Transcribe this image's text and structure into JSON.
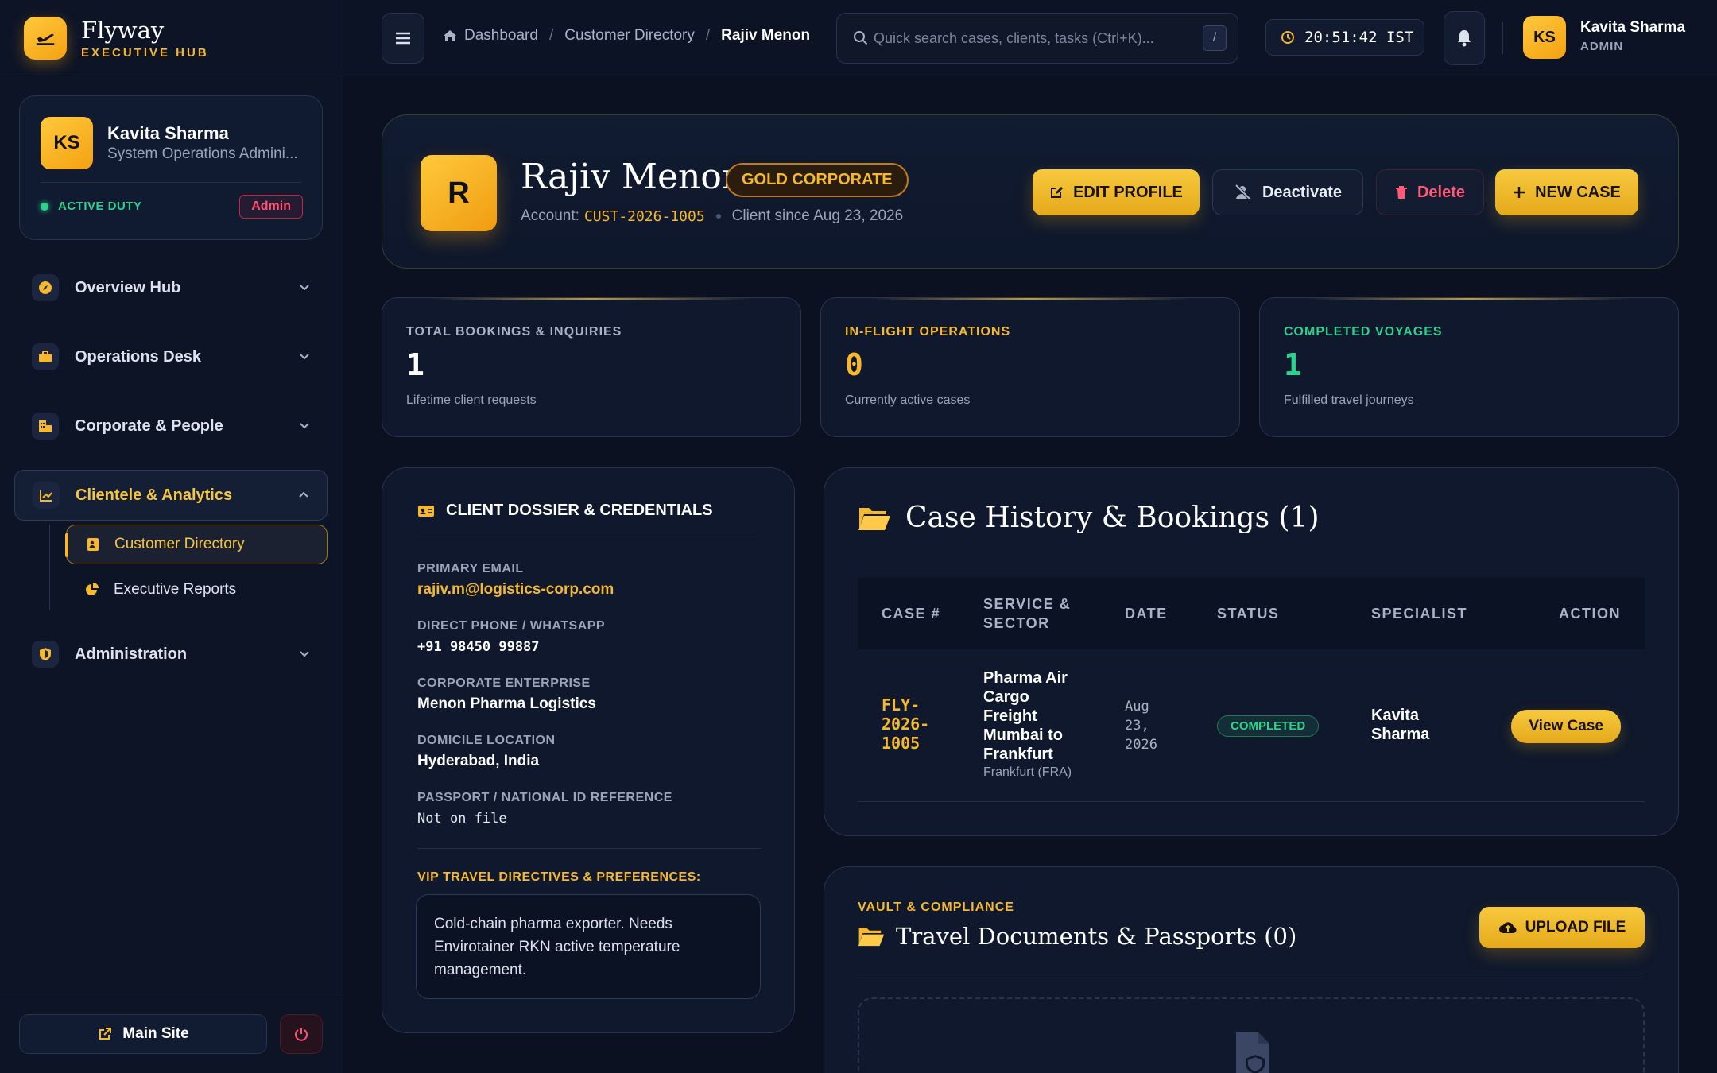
{
  "brand": {
    "name": "Flyway",
    "subtitle": "EXECUTIVE HUB"
  },
  "sidebar": {
    "user": {
      "initials": "KS",
      "name": "Kavita Sharma",
      "role": "System Operations Admini...",
      "status": "ACTIVE DUTY",
      "badge": "Admin"
    },
    "nav": [
      {
        "label": "Overview Hub",
        "icon": "compass-icon",
        "expanded": false
      },
      {
        "label": "Operations Desk",
        "icon": "briefcase-icon",
        "expanded": false
      },
      {
        "label": "Corporate & People",
        "icon": "building-icon",
        "expanded": false
      },
      {
        "label": "Clientele & Analytics",
        "icon": "chart-line-icon",
        "expanded": true
      },
      {
        "label": "Administration",
        "icon": "shield-icon",
        "expanded": false
      }
    ],
    "subnav": [
      {
        "label": "Customer Directory",
        "icon": "address-card-icon",
        "active": true
      },
      {
        "label": "Executive Reports",
        "icon": "pie-chart-icon",
        "active": false
      }
    ],
    "main_site": "Main Site"
  },
  "topbar": {
    "breadcrumb": [
      "Dashboard",
      "Customer Directory",
      "Rajiv Menon"
    ],
    "search_placeholder": "Quick search cases, clients, tasks (Ctrl+K)...",
    "search_shortcut": "/",
    "clock": "20:51:42 IST",
    "user": {
      "initials": "KS",
      "name": "Kavita Sharma",
      "role": "ADMIN"
    }
  },
  "client": {
    "initial": "R",
    "name": "Rajiv Menon",
    "tier": "GOLD CORPORATE",
    "account_label": "Account:",
    "account_id": "CUST-2026-1005",
    "since": "Client since Aug 23, 2026"
  },
  "actions": {
    "edit": "EDIT PROFILE",
    "deactivate": "Deactivate",
    "delete": "Delete",
    "new_case": "NEW CASE"
  },
  "stats": [
    {
      "label": "TOTAL BOOKINGS & INQUIRIES",
      "value": "1",
      "sub": "Lifetime client requests",
      "color": "#aab3c6"
    },
    {
      "label": "IN-FLIGHT OPERATIONS",
      "value": "0",
      "sub": "Currently active cases",
      "color": "#f5b82e"
    },
    {
      "label": "COMPLETED VOYAGES",
      "value": "1",
      "sub": "Fulfilled travel journeys",
      "color": "#2fd18f"
    }
  ],
  "dossier": {
    "title": "CLIENT DOSSIER & CREDENTIALS",
    "fields": [
      {
        "label": "PRIMARY EMAIL",
        "value": "rajiv.m@logistics-corp.com"
      },
      {
        "label": "DIRECT PHONE / WHATSAPP",
        "value": "+91 98450 99887"
      },
      {
        "label": "CORPORATE ENTERPRISE",
        "value": "Menon Pharma Logistics"
      },
      {
        "label": "DOMICILE LOCATION",
        "value": "Hyderabad, India"
      },
      {
        "label": "PASSPORT / NATIONAL ID REFERENCE",
        "value": "Not on file"
      }
    ],
    "vip_label": "VIP TRAVEL DIRECTIVES & PREFERENCES:",
    "vip_text": "Cold-chain pharma exporter. Needs Envirotainer RKN active temperature management."
  },
  "cases": {
    "title": "Case History & Bookings (1)",
    "headers": [
      "CASE #",
      "SERVICE & SECTOR",
      "DATE",
      "STATUS",
      "SPECIALIST",
      "ACTION"
    ],
    "rows": [
      {
        "case": "FLY-2026-1005",
        "service": "Pharma Air Cargo Freight Mumbai to Frankfurt",
        "sector": "Frankfurt (FRA)",
        "date": "Aug 23, 2026",
        "status": "COMPLETED",
        "specialist": "Kavita Sharma",
        "action": "View Case"
      }
    ]
  },
  "docs": {
    "subtitle": "VAULT & COMPLIANCE",
    "title": "Travel Documents & Passports (0)",
    "upload": "UPLOAD FILE"
  }
}
